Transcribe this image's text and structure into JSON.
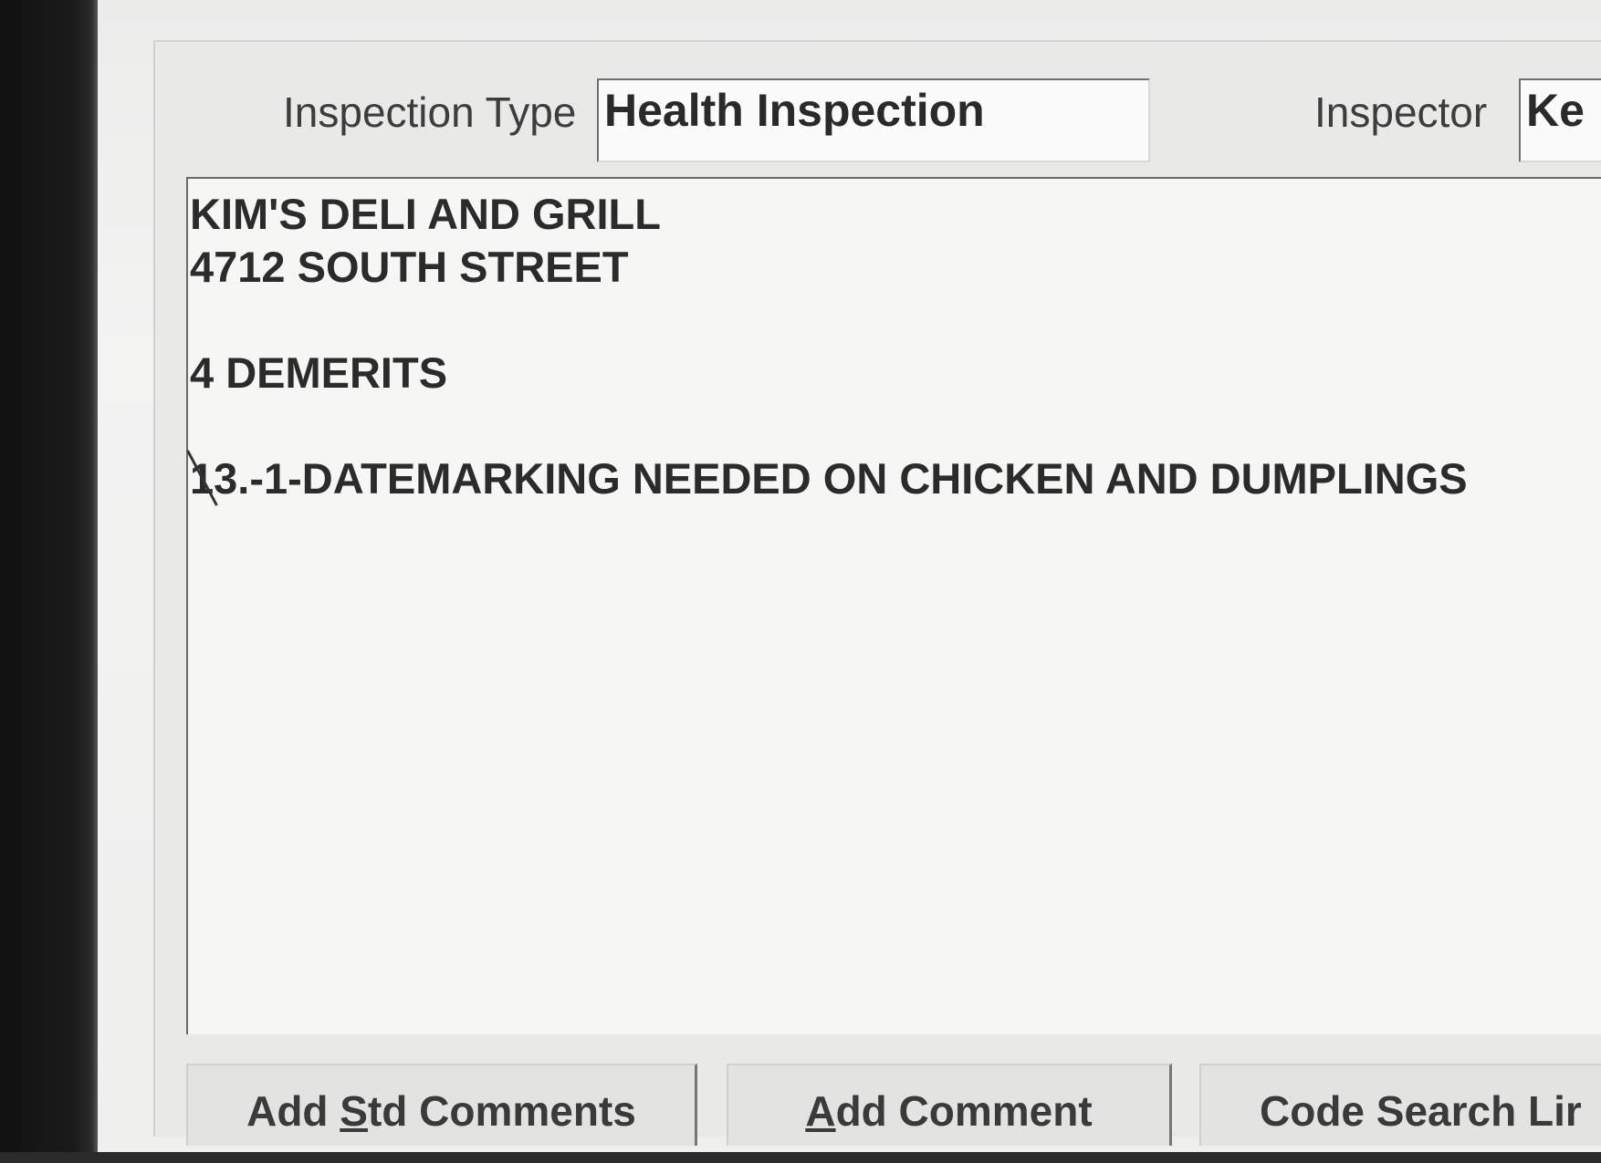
{
  "form": {
    "inspection_type_label": "Inspection Type",
    "inspection_type_value": "Health Inspection",
    "inspector_label": "Inspector",
    "inspector_value": "Ke"
  },
  "comments": {
    "lines": [
      "KIM'S DELI AND GRILL",
      "4712 SOUTH STREET",
      "",
      "4 DEMERITS",
      "",
      "13.-1-DATEMARKING NEEDED ON CHICKEN AND DUMPLINGS"
    ],
    "line1": "KIM'S DELI AND GRILL",
    "line2": "4712 SOUTH STREET",
    "line3": "4 DEMERITS",
    "line4_code": "13.",
    "line4_rest": "-1-DATEMARKING NEEDED ON CHICKEN AND DUMPLINGS"
  },
  "buttons": {
    "add_std_comments": {
      "pre": "Add ",
      "accel": "S",
      "post": "td Comments"
    },
    "add_comment": {
      "pre": "",
      "accel": "A",
      "post": "dd Comment"
    },
    "code_search": "Code Search Lir"
  }
}
